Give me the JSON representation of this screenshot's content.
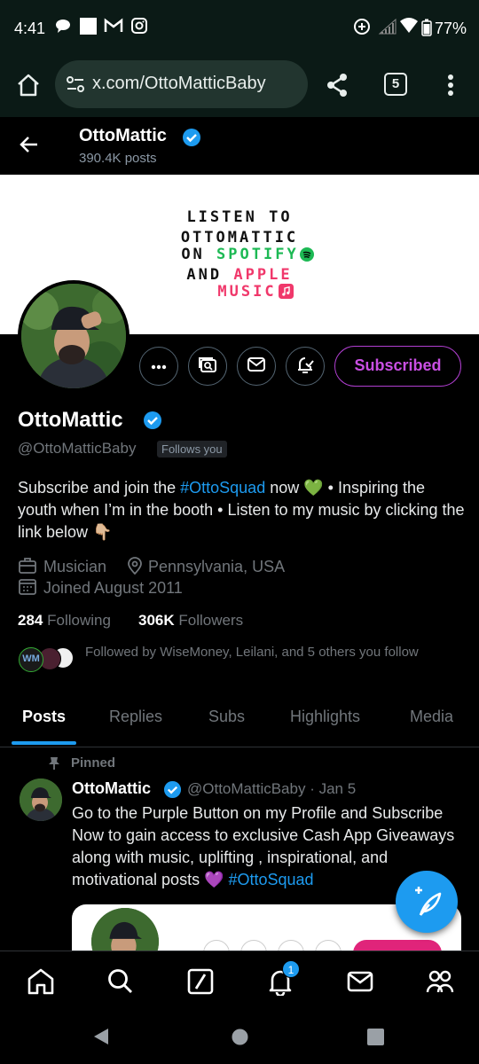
{
  "status_bar": {
    "time": "4:41",
    "battery": "77%"
  },
  "browser": {
    "url": "x.com/OttoMatticBaby",
    "tab_count": "5"
  },
  "header": {
    "name": "OttoMattic",
    "posts_count": "390.4K posts"
  },
  "banner": {
    "line1": "LISTEN TO",
    "line2": "OTTOMATTIC",
    "line3_prefix": "ON ",
    "line3_brand": "SPOTIFY",
    "line4_prefix": "AND ",
    "line4_brand": "APPLE",
    "line5": "MUSIC",
    "colors": {
      "spotify": "#1db954",
      "apple": "#f0386b"
    }
  },
  "profile": {
    "display_name": "OttoMattic",
    "handle": "@OttoMatticBaby",
    "follows_you": "Follows you",
    "subscribe_button": "Subscribed",
    "bio": {
      "part1": "Subscribe and join the ",
      "hashtag": "#OttoSquad",
      "part2": " now 💚 • Inspiring the youth when I’m in the booth • Listen to my music by clicking the link below 👇🏼"
    },
    "category": "Musician",
    "location": "Pennsylvania, USA",
    "joined": "Joined August 2011",
    "following_count": "284",
    "following_label": "Following",
    "followers_count": "306K",
    "followers_label": "Followers",
    "followed_by": "Followed by WiseMoney, Leilani, and 5 others you follow"
  },
  "tabs": [
    {
      "label": "Posts",
      "active": true
    },
    {
      "label": "Replies"
    },
    {
      "label": "Subs"
    },
    {
      "label": "Highlights"
    },
    {
      "label": "Media"
    }
  ],
  "pinned_post": {
    "pinned_label": "Pinned",
    "author": "OttoMattic",
    "handle_date": "@OttoMatticBaby · Jan 5",
    "text": "Go to the Purple Button on my Profile and Subscribe Now to gain access to exclusive Cash App Giveaways along with music, uplifting , inspirational, and motivational posts 💜 ",
    "hashtag": "#OttoSquad"
  },
  "bottom_nav": {
    "notifications_badge": "1"
  },
  "colors": {
    "accent": "#1d9bf0",
    "subscribe": "#c94fe3",
    "verified": "#1d9bf0"
  }
}
